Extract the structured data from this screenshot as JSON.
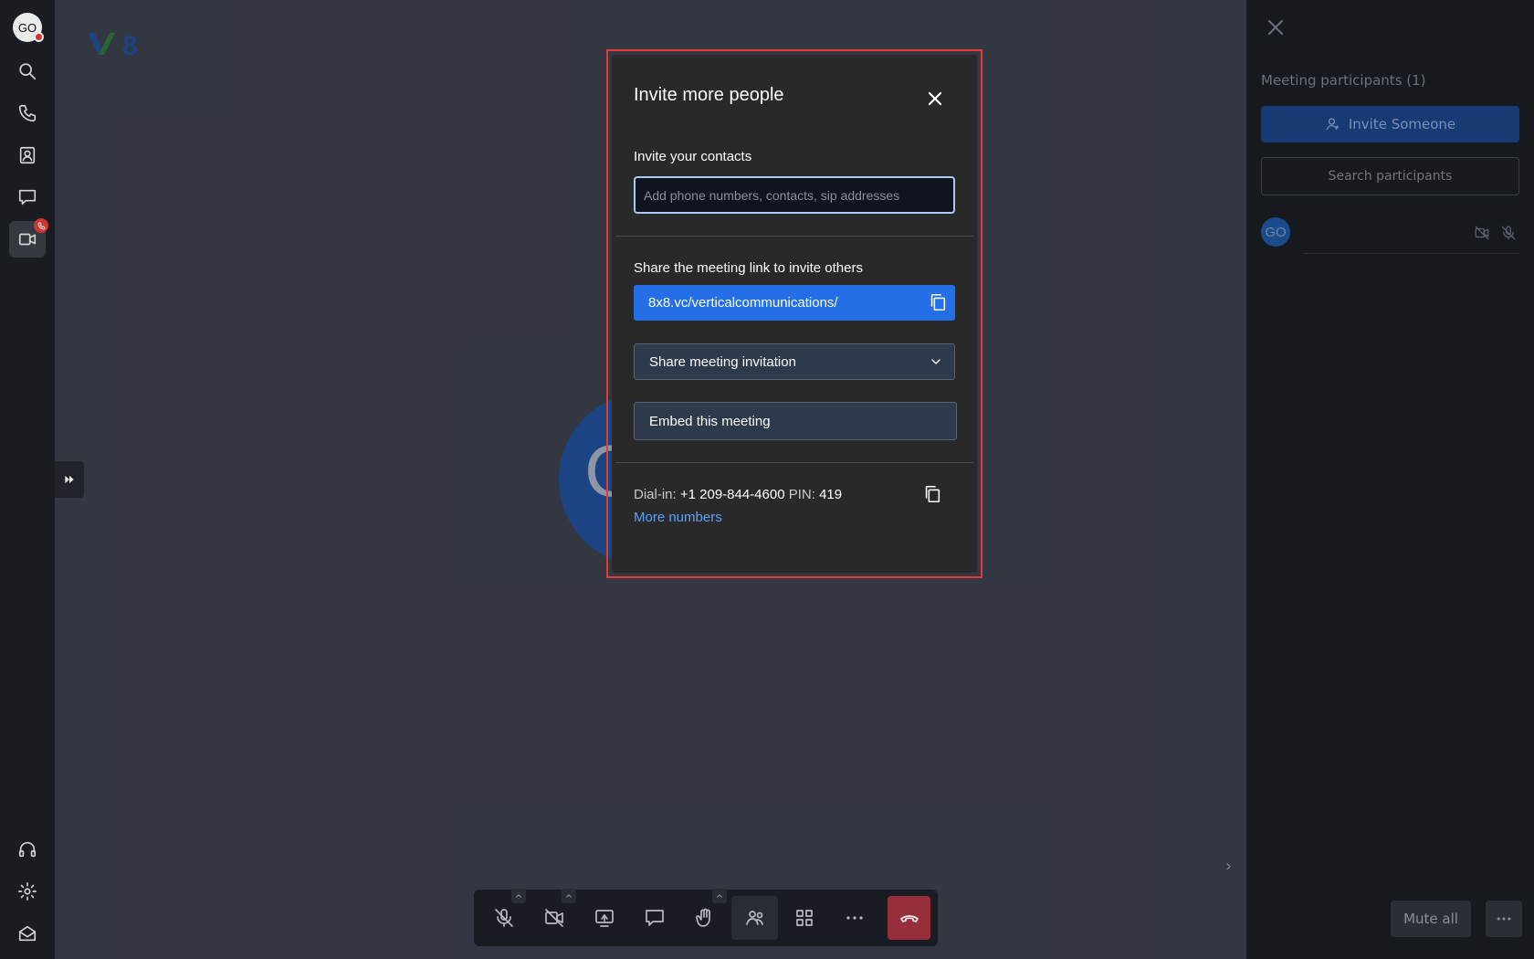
{
  "rail": {
    "avatar_initials": "GO",
    "items": [
      "search",
      "phone",
      "contacts",
      "chat",
      "video",
      "support",
      "settings",
      "inbox"
    ]
  },
  "stage": {
    "avatar_letter": "C"
  },
  "toolbar": {
    "buttons": [
      "mic-off",
      "camera-off",
      "share-screen",
      "chat",
      "raise-hand",
      "participants",
      "tile-view",
      "more",
      "hang-up"
    ]
  },
  "panel": {
    "title": "Meeting participants (1)",
    "invite_button": "Invite Someone",
    "search_placeholder": "Search participants",
    "participant_initials": "GO",
    "mute_all": "Mute all"
  },
  "modal": {
    "title": "Invite more people",
    "contacts_label": "Invite your contacts",
    "contacts_placeholder": "Add phone numbers, contacts, sip addresses",
    "share_label": "Share the meeting link to invite others",
    "meeting_link": "8x8.vc/verticalcommunications/",
    "share_invitation": "Share meeting invitation",
    "embed": "Embed this meeting",
    "dialin_label": "Dial-in:",
    "dialin_number": "+1 209-844-4600",
    "pin_label": "PIN:",
    "pin": "419",
    "more_numbers": "More numbers"
  },
  "colors": {
    "accent": "#246fe5",
    "highlight": "#e53935",
    "stage_bg": "#383c48",
    "panel_bg": "#16191e"
  }
}
